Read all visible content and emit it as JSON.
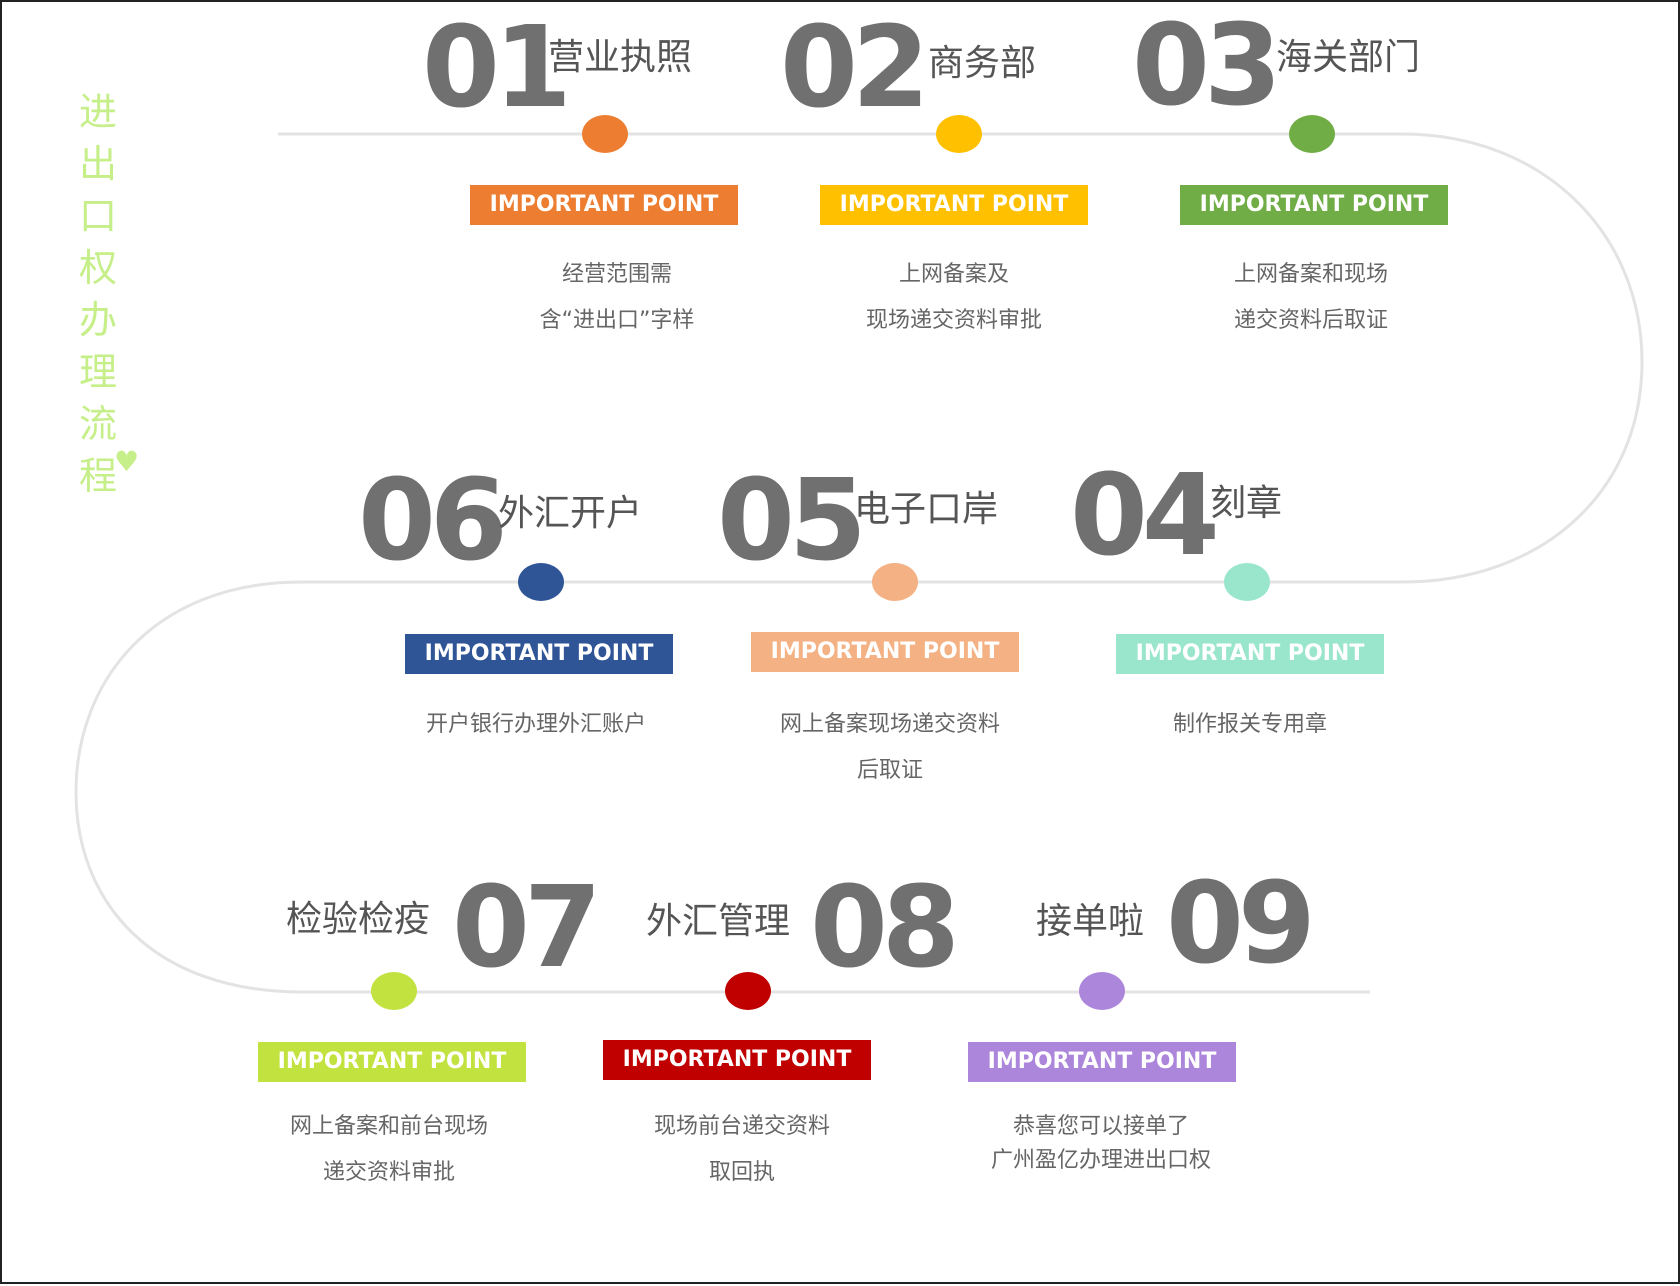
{
  "title_chars": [
    "进",
    "出",
    "口",
    "权",
    "办",
    "理",
    "流",
    "程"
  ],
  "title_heart": "♥",
  "badge_label": "IMPORTANT POINT",
  "colors": {
    "path": "#e3e3e3",
    "number": "#707070",
    "title_accent": "#c6ef8a"
  },
  "steps": [
    {
      "num": "01",
      "title": "营业执照",
      "color": "#ed7d31",
      "desc": [
        "经营范围需",
        "含“进出口”字样"
      ]
    },
    {
      "num": "02",
      "title": "商务部",
      "color": "#ffc000",
      "desc": [
        "上网备案及",
        "现场递交资料审批"
      ]
    },
    {
      "num": "03",
      "title": "海关部门",
      "color": "#70ad47",
      "desc": [
        "上网备案和现场",
        "递交资料后取证"
      ]
    },
    {
      "num": "04",
      "title": "刻章",
      "color": "#9ae6cc",
      "desc": [
        "制作报关专用章"
      ]
    },
    {
      "num": "05",
      "title": "电子口岸",
      "color": "#f4b183",
      "desc": [
        "网上备案现场递交资料",
        "后取证"
      ]
    },
    {
      "num": "06",
      "title": "外汇开户",
      "color": "#2f5597",
      "desc": [
        "开户银行办理外汇账户"
      ]
    },
    {
      "num": "07",
      "title": "检验检疫",
      "color": "#c2e23f",
      "desc": [
        "网上备案和前台现场",
        "递交资料审批"
      ]
    },
    {
      "num": "08",
      "title": "外汇管理",
      "color": "#c00000",
      "desc": [
        "现场前台递交资料",
        "取回执"
      ]
    },
    {
      "num": "09",
      "title": "接单啦",
      "color": "#ac86db",
      "desc": [
        "恭喜您可以接单了",
        "广州盈亿办理进出口权"
      ]
    }
  ]
}
